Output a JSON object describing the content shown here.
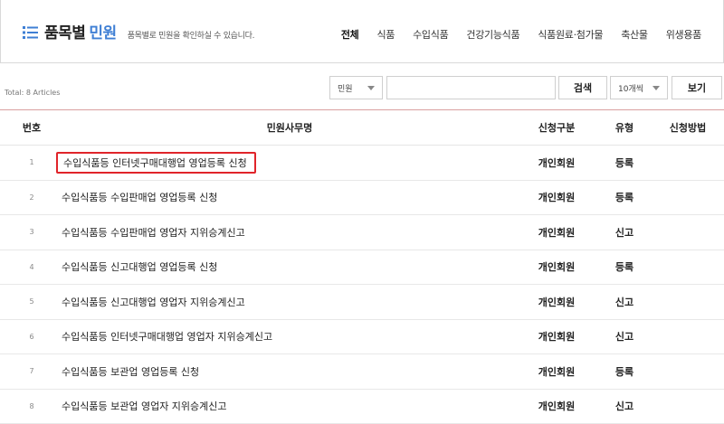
{
  "header": {
    "title_main": "품목별",
    "title_accent": "민원",
    "subtitle": "품목별로 민원을 확인하실 수 있습니다.",
    "accent_color": "#3f7fd4",
    "categories": [
      "전체",
      "식품",
      "수입식품",
      "건강기능식품",
      "식품원료·첨가물",
      "축산물",
      "위생용품"
    ]
  },
  "toolbar": {
    "total_text": "Total: 8 Articles",
    "filter_select": "민원",
    "search_value": "",
    "search_button": "검색",
    "page_size_select": "10개씩",
    "view_button": "보기"
  },
  "table": {
    "headers": {
      "no": "번호",
      "name": "민원사무명",
      "type": "신청구분",
      "kind": "유형",
      "method": "신청방법"
    },
    "rows": [
      {
        "no": "1",
        "name": "수입식품등 인터넷구매대행업 영업등록 신청",
        "type": "개인회원",
        "kind": "등록",
        "method": ""
      },
      {
        "no": "2",
        "name": "수입식품등 수입판매업 영업등록 신청",
        "type": "개인회원",
        "kind": "등록",
        "method": ""
      },
      {
        "no": "3",
        "name": "수입식품등 수입판매업 영업자 지위승계신고",
        "type": "개인회원",
        "kind": "신고",
        "method": ""
      },
      {
        "no": "4",
        "name": "수입식품등 신고대행업 영업등록 신청",
        "type": "개인회원",
        "kind": "등록",
        "method": ""
      },
      {
        "no": "5",
        "name": "수입식품등 신고대행업 영업자 지위승계신고",
        "type": "개인회원",
        "kind": "신고",
        "method": ""
      },
      {
        "no": "6",
        "name": "수입식품등 인터넷구매대행업 영업자 지위승계신고",
        "type": "개인회원",
        "kind": "신고",
        "method": ""
      },
      {
        "no": "7",
        "name": "수입식품등 보관업 영업등록 신청",
        "type": "개인회원",
        "kind": "등록",
        "method": ""
      },
      {
        "no": "8",
        "name": "수입식품등 보관업 영업자 지위승계신고",
        "type": "개인회원",
        "kind": "신고",
        "method": ""
      }
    ],
    "highlight_color": "#e0242a"
  }
}
